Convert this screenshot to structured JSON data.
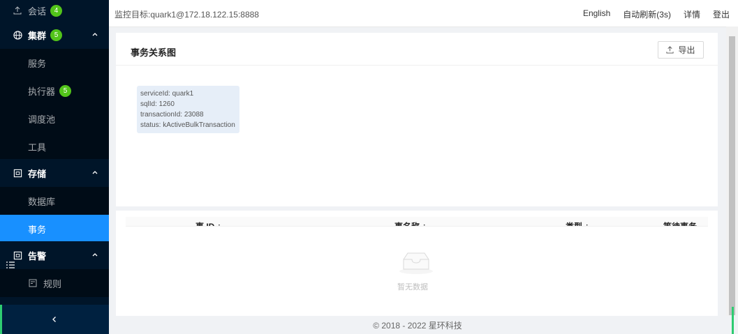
{
  "sidebar": {
    "top_item": {
      "label": "会话",
      "badge": "4"
    },
    "groups": [
      {
        "label": "集群",
        "badge": "5",
        "icon": "globe-icon"
      },
      {
        "label": "存储",
        "icon": "storage-icon"
      },
      {
        "label": "告警",
        "icon": "alert-icon"
      }
    ],
    "items": {
      "service": "服务",
      "executor": "执行器",
      "executor_badge": "5",
      "scheduler": "调度池",
      "tools": "工具",
      "database": "数据库",
      "transaction": "事务",
      "rules": "规则"
    },
    "collapse_icon": "chevron-left-icon"
  },
  "header": {
    "target": "监控目标:quark1@172.18.122.15:8888",
    "links": [
      "English",
      "自动刷新(3s)",
      "详情",
      "登出"
    ]
  },
  "graph_card": {
    "title": "事务关系图",
    "export_label": "导出",
    "node": {
      "line1": "serviceId: quark1",
      "line2": "sqlId: 1260",
      "line3": "transactionId: 23088",
      "line4": "status: kActiveBulkTransaction"
    }
  },
  "table": {
    "columns": [
      "事 ID ÷",
      "事名称 ÷",
      "类型 ÷",
      "等待事务"
    ],
    "empty_text": "暂无数据"
  },
  "footer": {
    "text": "© 2018 - 2022 星环科技"
  },
  "colors": {
    "sidebar_bg": "#001529",
    "active": "#1890ff",
    "badge": "#52c41a"
  }
}
